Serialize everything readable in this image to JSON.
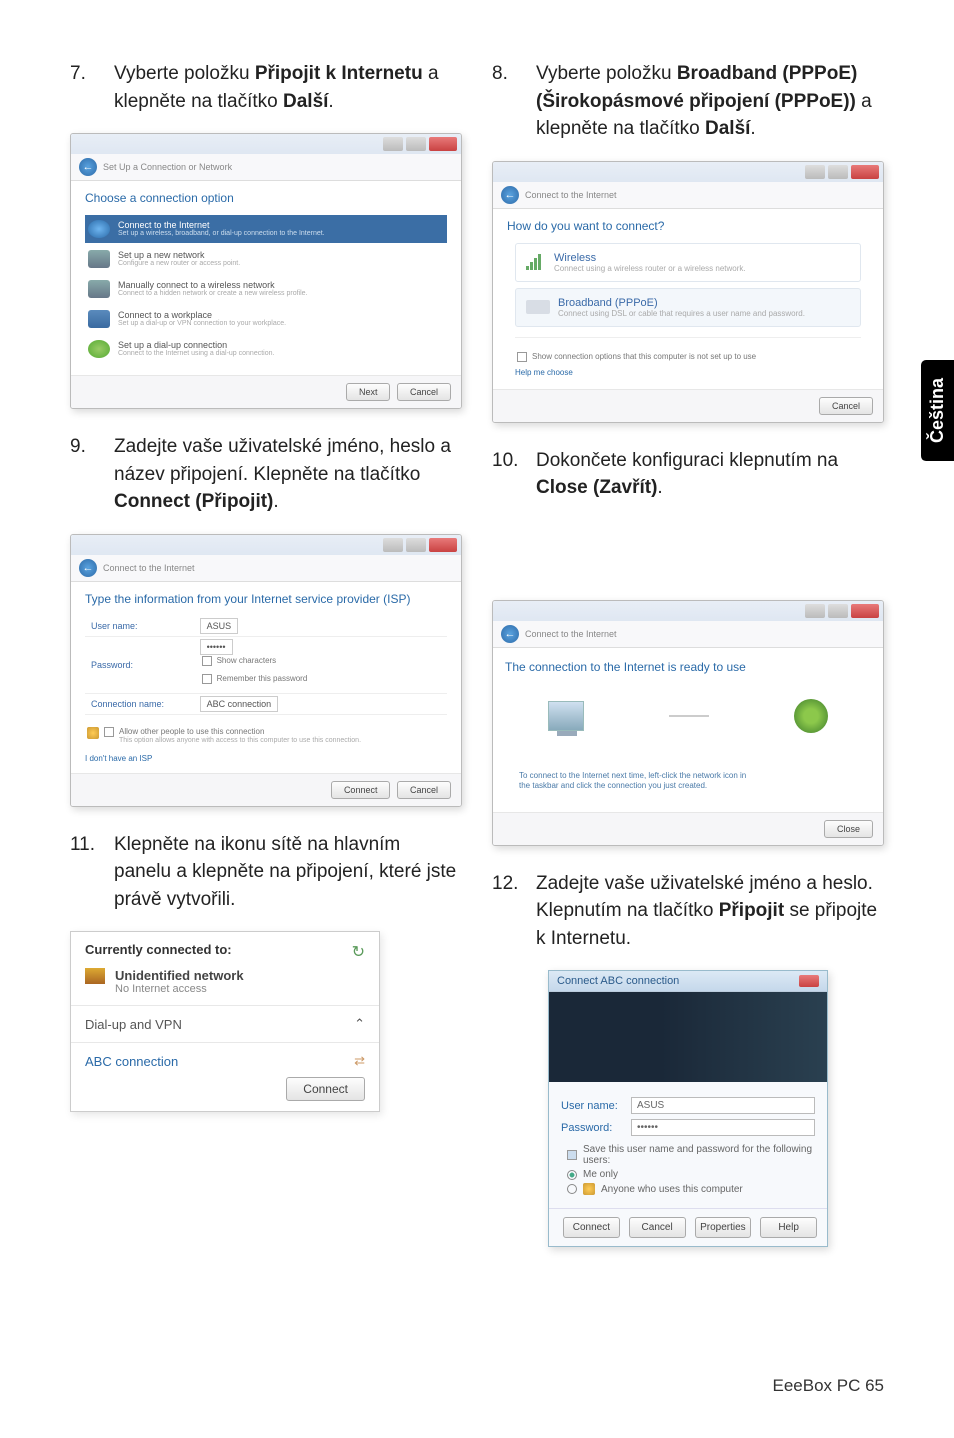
{
  "sideTab": "Čeština",
  "footer": "EeeBox PC    65",
  "step7": {
    "num": "7.",
    "text_parts": [
      "Vyberte položku ",
      "Připojit k Internetu",
      " a klepněte na tlačítko ",
      "Další",
      "."
    ]
  },
  "step8": {
    "num": "8.",
    "text_parts": [
      "Vyberte položku ",
      "Broadband (PPPoE) (Širokopásmové připojení (PPPoE))",
      "  a klepněte na tlačítko ",
      "Další",
      "."
    ]
  },
  "step9": {
    "num": "9.",
    "text_parts": [
      "Zadejte vaše uživatelské jméno, heslo a název připojení. Klepněte na tlačítko ",
      "Connect (Připojit)",
      "."
    ]
  },
  "step10": {
    "num": "10.",
    "text_parts": [
      "Dokončete konfiguraci klepnutím na ",
      "Close (Zavřít)",
      "."
    ]
  },
  "step11": {
    "num": "11.",
    "text": "Klepněte na ikonu sítě na hlavním panelu a klepněte na připojení, které jste právě vytvořili."
  },
  "step12": {
    "num": "12.",
    "text_parts": [
      "Zadejte vaše uživatelské jméno a heslo. Klepnutím na tlačítko ",
      "Připojit",
      " se připojte k Internetu."
    ]
  },
  "wizard7": {
    "breadcrumb": "Set Up a Connection or Network",
    "title": "Choose a connection option",
    "options": [
      {
        "main": "Connect to the Internet",
        "sub": "Set up a wireless, broadband, or dial-up connection to the Internet."
      },
      {
        "main": "Set up a new network",
        "sub": "Configure a new router or access point."
      },
      {
        "main": "Manually connect to a wireless network",
        "sub": "Connect to a hidden network or create a new wireless profile."
      },
      {
        "main": "Connect to a workplace",
        "sub": "Set up a dial-up or VPN connection to your workplace."
      },
      {
        "main": "Set up a dial-up connection",
        "sub": "Connect to the Internet using a dial-up connection."
      }
    ],
    "next": "Next",
    "cancel": "Cancel"
  },
  "wizard8": {
    "breadcrumb": "Connect to the Internet",
    "title": "How do you want to connect?",
    "wireless": {
      "main": "Wireless",
      "sub": "Connect using a wireless router or a wireless network."
    },
    "broadband": {
      "main": "Broadband (PPPoE)",
      "sub": "Connect using DSL or cable that requires a user name and password."
    },
    "help": "Show connection options that this computer is not set up to use",
    "helpme": "Help me choose",
    "cancel": "Cancel"
  },
  "wizard9": {
    "breadcrumb": "Connect to the Internet",
    "title": "Type the information from your Internet service provider (ISP)",
    "user_label": "User name:",
    "user_val": "ASUS",
    "pass_label": "Password:",
    "pass_val": "••••••",
    "show_chars": "Show characters",
    "remember": "Remember this password",
    "conn_label": "Connection name:",
    "conn_val": "ABC connection",
    "allow": "Allow other people to use this connection",
    "allow_sub": "This option allows anyone with access to this computer to use this connection.",
    "noisp": "I don't have an ISP",
    "connect": "Connect",
    "cancel": "Cancel"
  },
  "wizard10": {
    "breadcrumb": "Connect to the Internet",
    "title": "The connection to the Internet is ready to use",
    "note1": "To connect to the Internet next time, left-click the network icon in",
    "note2": "the taskbar and click the connection you just created.",
    "close": "Close"
  },
  "tray": {
    "title": "Currently connected to:",
    "netname": "Unidentified network",
    "netsub": "No Internet access",
    "section": "Dial-up and VPN",
    "conn": "ABC connection",
    "connect": "Connect"
  },
  "dial": {
    "title": "Connect ABC connection",
    "user_label": "User name:",
    "user_val": "ASUS",
    "pass_label": "Password:",
    "pass_val": "••••••",
    "save": "Save this user name and password for the following users:",
    "me": "Me only",
    "anyone": "Anyone who uses this computer",
    "connect": "Connect",
    "cancel": "Cancel",
    "props": "Properties",
    "help": "Help"
  }
}
